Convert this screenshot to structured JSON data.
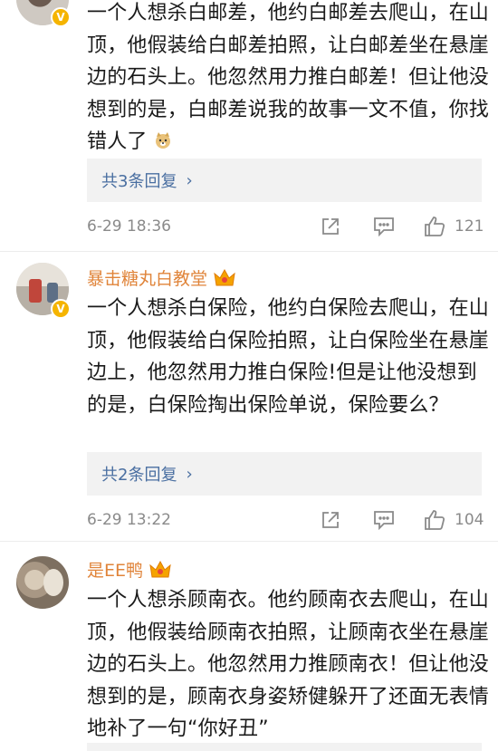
{
  "comments": [
    {
      "username": "",
      "text": "一个人想杀白邮差，他约白邮差去爬山，在山顶，他假装给白邮差拍照，让白邮差坐在悬崖边的石头上。他忽然用力推白邮差！但让他没想到的是，白邮差说我的故事一文不值，你找错人了",
      "has_emoji": true,
      "emoji": "doge-emoji",
      "replies_label": "共3条回复",
      "time": "6-29 18:36",
      "likes": "121"
    },
    {
      "username": "暴击糖丸白教堂",
      "text": "一个人想杀白保险，他约白保险去爬山，在山顶，他假装给白保险拍照，让白保险坐在悬崖边上，他忽然用力推白保险!但是让他没想到的是，白保险掏出保险单说，保险要么？",
      "replies_label": "共2条回复",
      "time": "6-29 13:22",
      "likes": "104"
    },
    {
      "username": "是EE鸭",
      "text": "一个人想杀顾南衣。他约顾南衣去爬山，在山顶，他假装给顾南衣拍照，让顾南衣坐在悬崖边的石头上。他忽然用力推顾南衣！但让他没想到的是，顾南衣身姿矫健躲开了还面无表情地补了一句“你好丑”"
    }
  ],
  "colors": {
    "username": "#e0843a",
    "reply_link": "#4a6fa1",
    "meta": "#8a8a8a",
    "vip_badge": "#f5b400"
  },
  "icons": [
    "verified-badge-icon",
    "vip-crown-icon",
    "share-icon",
    "comment-icon",
    "like-icon",
    "chevron-right-icon"
  ]
}
